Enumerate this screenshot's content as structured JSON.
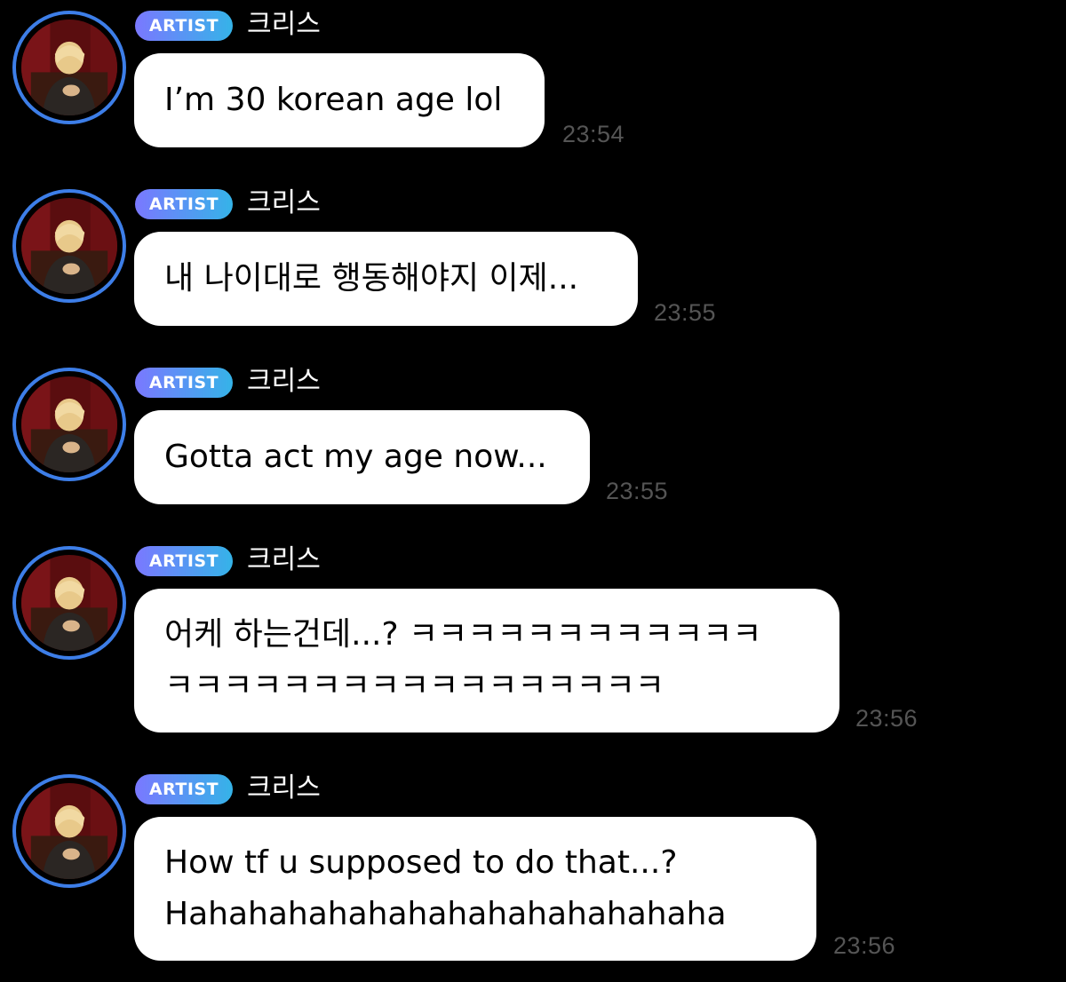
{
  "artist_badge": "ARTIST",
  "sender_name": "크리스",
  "colors": {
    "background": "#000000",
    "bubble": "#ffffff",
    "avatar_ring": "#3d7ee8",
    "badge_gradient_start": "#7a78ff",
    "badge_gradient_end": "#35b3e8",
    "timestamp": "#555555"
  },
  "messages": [
    {
      "lines": [
        "I’m 30 korean age lol"
      ],
      "time": "23:54"
    },
    {
      "lines": [
        "내 나이대로 행동해야지 이제..."
      ],
      "time": "23:55"
    },
    {
      "lines": [
        "Gotta act my age now..."
      ],
      "time": "23:55"
    },
    {
      "lines": [
        "어케 하는건데...? ㅋㅋㅋㅋㅋㅋㅋㅋㅋㅋㅋㅋ",
        "ㅋㅋㅋㅋㅋㅋㅋㅋㅋㅋㅋㅋㅋㅋㅋㅋㅋ"
      ],
      "time": "23:56"
    },
    {
      "lines": [
        "How tf u supposed to do that...?",
        "Hahahahahahahahahahahahahaha"
      ],
      "time": "23:56"
    }
  ]
}
